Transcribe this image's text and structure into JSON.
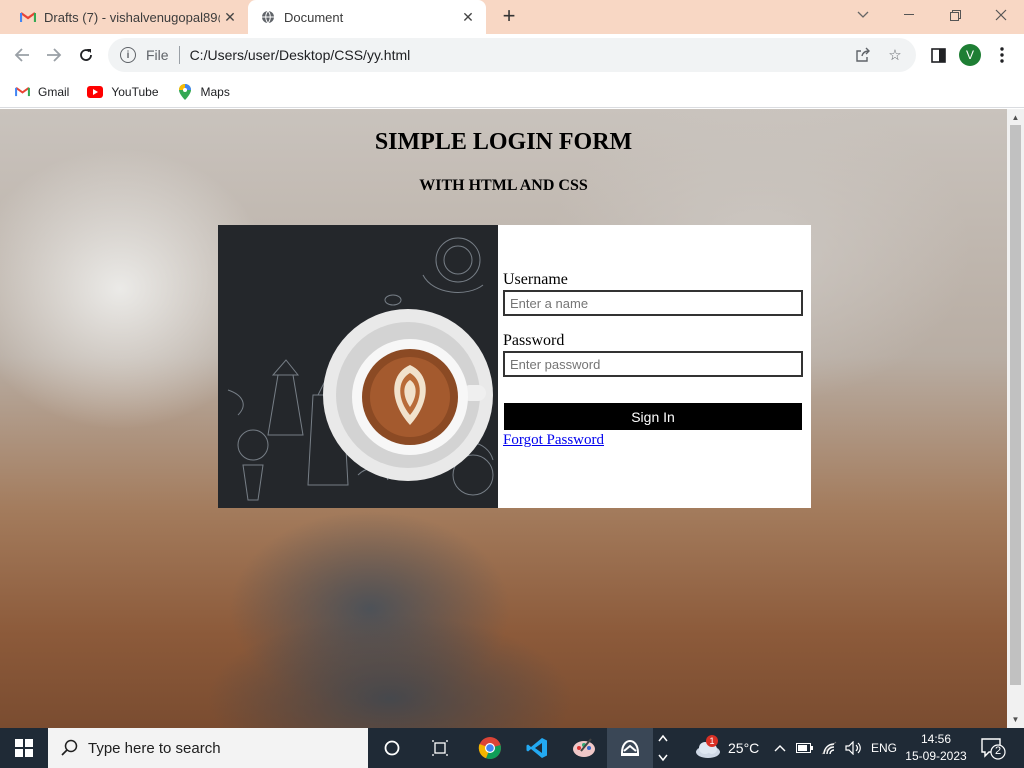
{
  "browser": {
    "tabs": [
      {
        "title": "Drafts (7) - vishalvenugopal89@",
        "active": false
      },
      {
        "title": "Document",
        "active": true
      }
    ],
    "address": {
      "scheme": "File",
      "url": "C:/Users/user/Desktop/CSS/yy.html"
    },
    "profile_initial": "V",
    "bookmarks": [
      {
        "label": "Gmail",
        "icon": "gmail-icon"
      },
      {
        "label": "YouTube",
        "icon": "youtube-icon"
      },
      {
        "label": "Maps",
        "icon": "maps-icon"
      }
    ]
  },
  "page": {
    "title": "SIMPLE LOGIN FORM",
    "subtitle": "WITH HTML AND CSS",
    "form": {
      "username_label": "Username",
      "username_placeholder": "Enter a name",
      "password_label": "Password",
      "password_placeholder": "Enter password",
      "signin_label": "Sign In",
      "forgot_label": "Forgot Password"
    }
  },
  "taskbar": {
    "search_placeholder": "Type here to search",
    "weather": {
      "temp": "25°C",
      "badge": "1"
    },
    "language": "ENG",
    "time": "14:56",
    "date": "15-09-2023",
    "notifications": "2"
  },
  "colors": {
    "tabstrip": "#f8d7c4",
    "signin_bg": "#000000",
    "link": "#0000ee",
    "taskbar": "#1f2a36"
  }
}
